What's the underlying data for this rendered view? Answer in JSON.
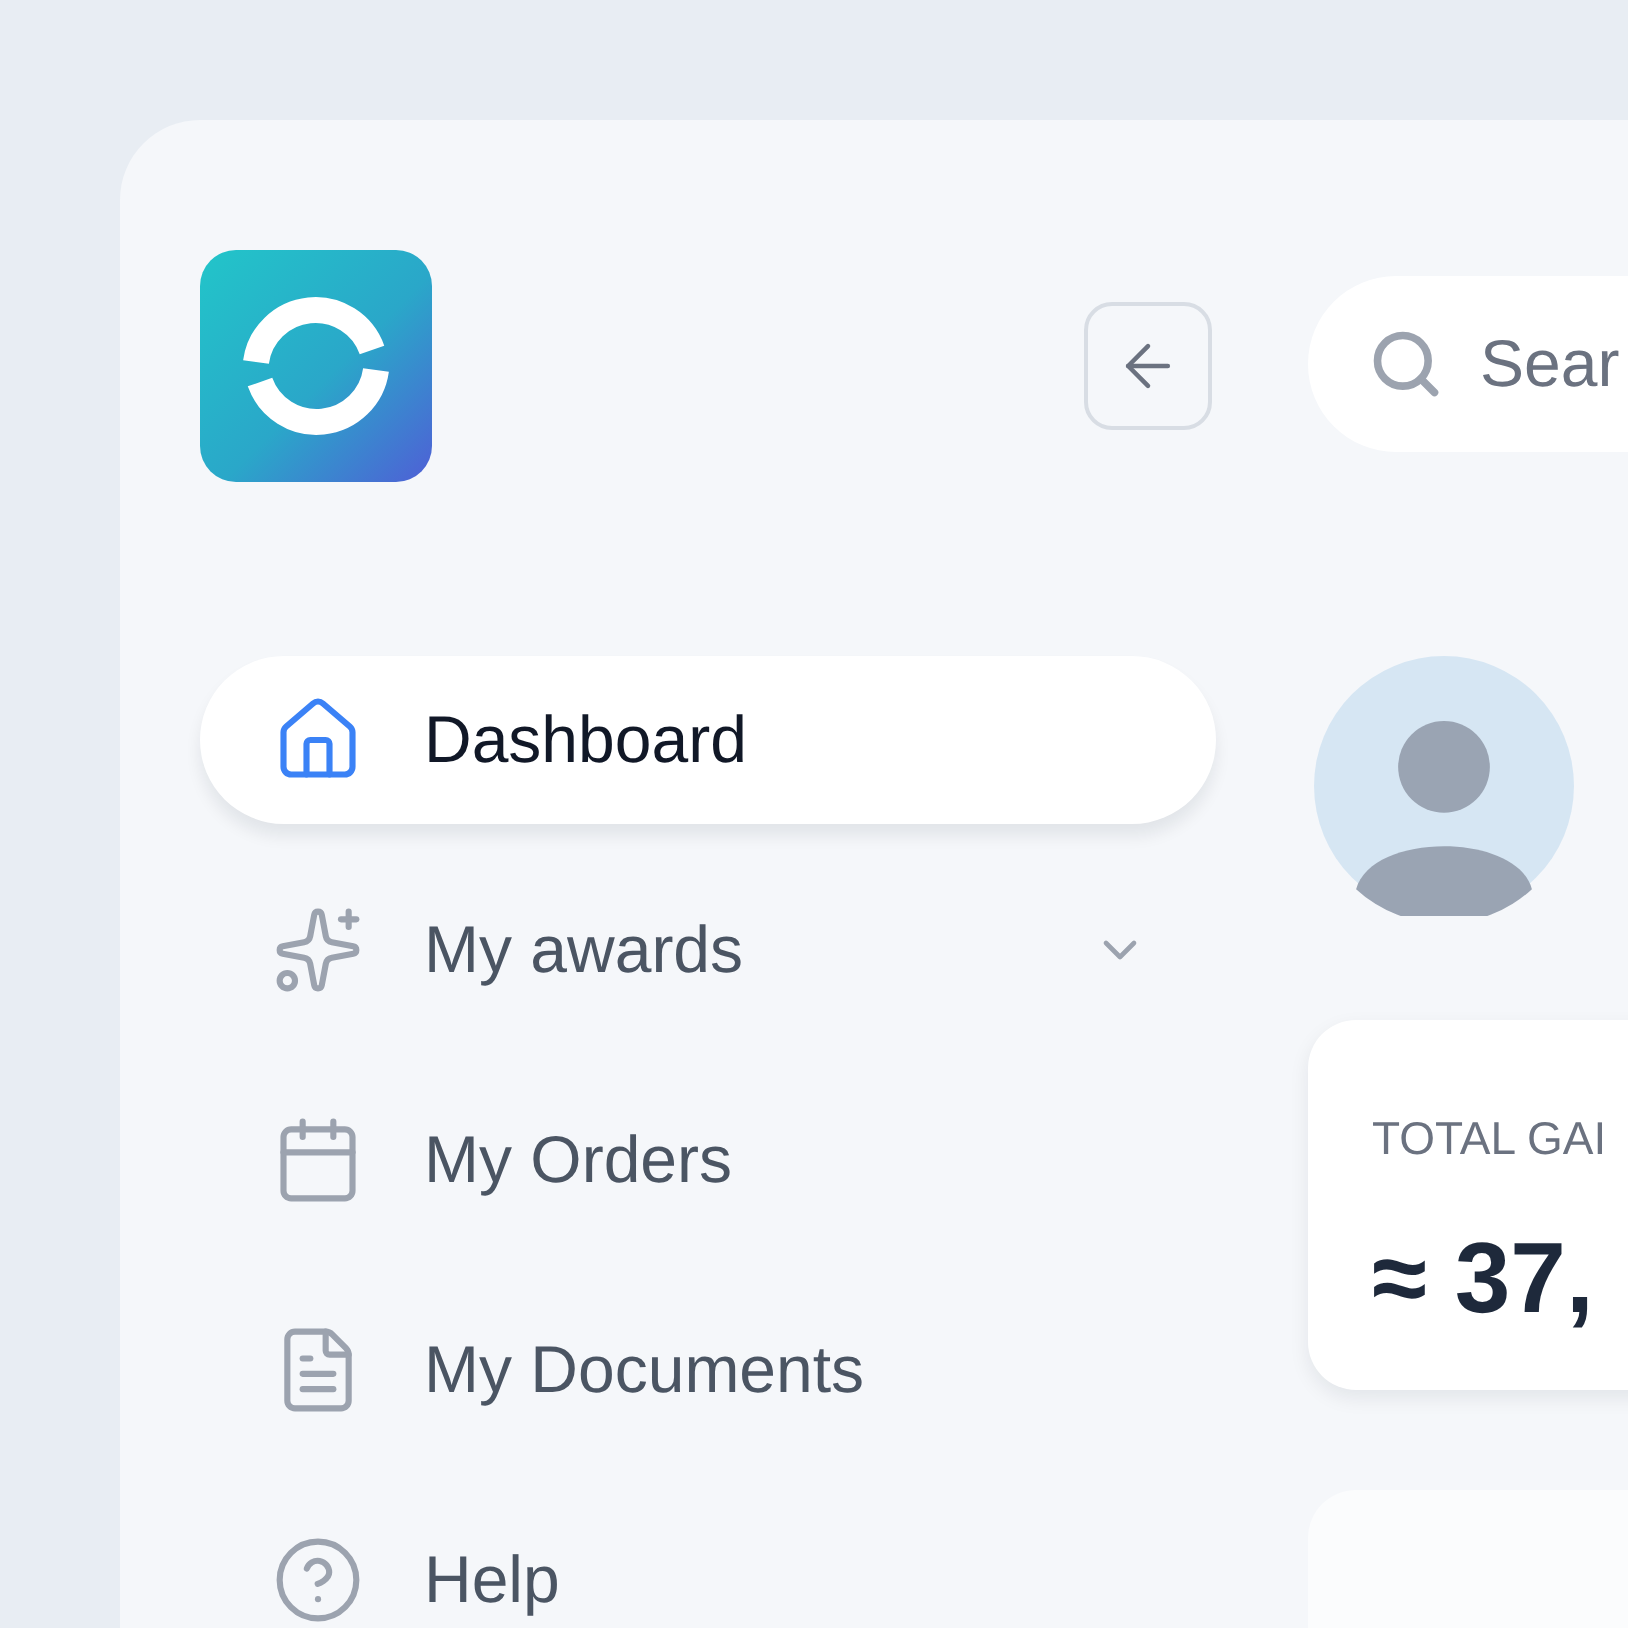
{
  "sidebar": {
    "items": [
      {
        "label": "Dashboard",
        "selected": true
      },
      {
        "label": "My awards",
        "selected": false,
        "expanded": false
      },
      {
        "label": "My Orders",
        "selected": false
      },
      {
        "label": "My Documents",
        "selected": false
      },
      {
        "label": "Help",
        "selected": false
      }
    ]
  },
  "search": {
    "placeholder": "Sear"
  },
  "stat_card": {
    "label": "TOTAL GAI",
    "value": "≈ 37,"
  }
}
